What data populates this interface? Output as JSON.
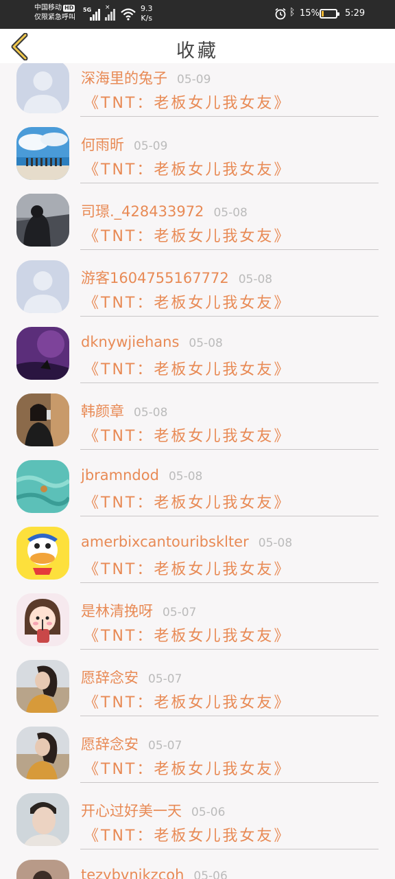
{
  "status_bar": {
    "carrier_line1": "中国移动",
    "carrier_hd": "HD",
    "carrier_line2": "仅限紧急呼叫",
    "network": "5G",
    "speed_value": "9.3",
    "speed_unit": "K/s",
    "battery_pct": "15%",
    "battery_level": 0.15,
    "time": "5:29"
  },
  "header": {
    "title": "收藏"
  },
  "items": [
    {
      "name": "深海里的兔子",
      "date": "05-09",
      "title": "《TNT：老板女儿我女友》",
      "avatar": "default"
    },
    {
      "name": "何雨昕",
      "date": "05-09",
      "title": "《TNT：老板女儿我女友》",
      "avatar": "beach"
    },
    {
      "name": "司璟._428433972",
      "date": "05-08",
      "title": "《TNT：老板女儿我女友》",
      "avatar": "dark-figure"
    },
    {
      "name": "游客1604755167772",
      "date": "05-08",
      "title": "《TNT：老板女儿我女友》",
      "avatar": "default"
    },
    {
      "name": "dknywjiehans",
      "date": "05-08",
      "title": "《TNT：老板女儿我女友》",
      "avatar": "purple-scene"
    },
    {
      "name": "韩颜章",
      "date": "05-08",
      "title": "《TNT：老板女儿我女友》",
      "avatar": "girl-selfie"
    },
    {
      "name": "jbramndod",
      "date": "05-08",
      "title": "《TNT：老板女儿我女友》",
      "avatar": "sea"
    },
    {
      "name": "amerbixcantouribsklter",
      "date": "05-08",
      "title": "《TNT：老板女儿我女友》",
      "avatar": "duck"
    },
    {
      "name": "是林清挽呀",
      "date": "05-07",
      "title": "《TNT：老板女儿我女友》",
      "avatar": "cartoon-girl"
    },
    {
      "name": "愿辞念安",
      "date": "05-07",
      "title": "《TNT：老板女儿我女友》",
      "avatar": "ponytail-girl"
    },
    {
      "name": "愿辞念安",
      "date": "05-07",
      "title": "《TNT：老板女儿我女友》",
      "avatar": "ponytail-girl"
    },
    {
      "name": "开心过好美一天",
      "date": "05-06",
      "title": "《TNT：老板女儿我女友》",
      "avatar": "man-portrait"
    },
    {
      "name": "tezybvnjkzcoh",
      "date": "05-06",
      "title": "",
      "avatar": "partial"
    }
  ]
}
